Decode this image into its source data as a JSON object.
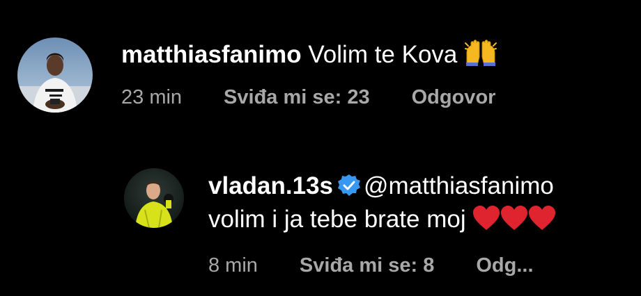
{
  "comment": {
    "username": "matthiasfanimo",
    "text": "Volim te Kova",
    "emoji": "raised-hands-emoji",
    "time": "23 min",
    "likes": "Sviđa mi se: 23",
    "reply": "Odgovor"
  },
  "reply": {
    "username": "vladan.13s",
    "verified": true,
    "mention": "@matthiasfanimo",
    "text": "volim i ja tebe brate moj",
    "hearts": [
      "red-heart-emoji",
      "red-heart-emoji",
      "red-heart-emoji"
    ],
    "time": "8 min",
    "likes": "Sviđa mi se: 8",
    "reply": "Odg..."
  },
  "colors": {
    "background": "#000000",
    "text": "#ffffff",
    "meta": "#a8a8a8",
    "verified": "#3897f0",
    "heart": "#e0242f",
    "emoji": "#f5b820"
  }
}
